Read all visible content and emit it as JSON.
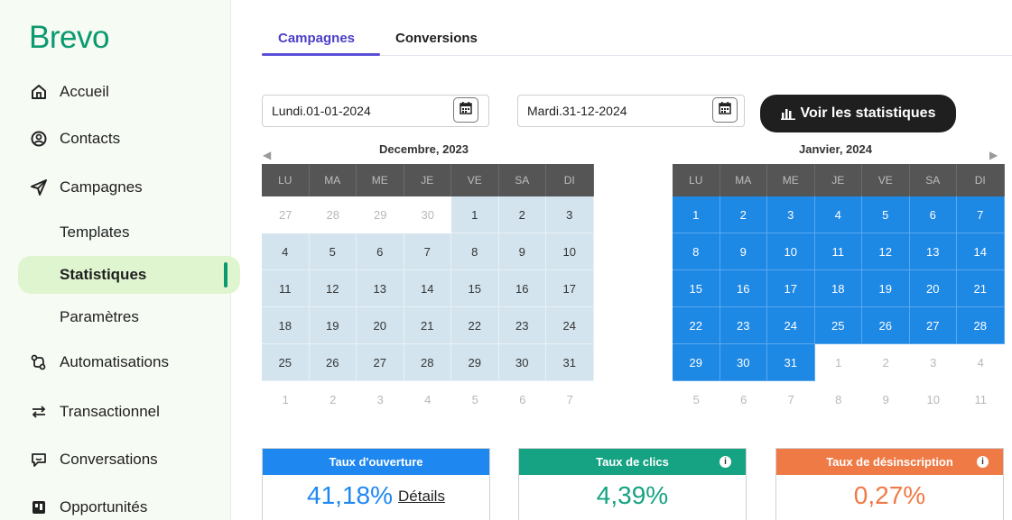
{
  "brand": {
    "logo": "Brevo"
  },
  "sidebar": {
    "items": [
      {
        "label": "Accueil",
        "icon": "home-icon"
      },
      {
        "label": "Contacts",
        "icon": "contacts-icon"
      },
      {
        "label": "Campagnes",
        "icon": "paper-plane-icon"
      }
    ],
    "sub_items": [
      {
        "label": "Templates"
      },
      {
        "label": "Statistiques",
        "active": true
      },
      {
        "label": "Paramètres"
      }
    ],
    "items_after": [
      {
        "label": "Automatisations",
        "icon": "automation-icon"
      },
      {
        "label": "Transactionnel",
        "icon": "transfer-icon"
      },
      {
        "label": "Conversations",
        "icon": "chat-icon"
      },
      {
        "label": "Opportunités",
        "icon": "opportunity-icon"
      }
    ]
  },
  "tabs": {
    "campagnes": "Campagnes",
    "conversions": "Conversions"
  },
  "dates": {
    "start": "Lundi.01-01-2024",
    "end": "Mardi.31-12-2024",
    "button": "Voir les statistiques"
  },
  "calendars": {
    "weekdays": [
      "LU",
      "MA",
      "ME",
      "JE",
      "VE",
      "SA",
      "DI"
    ],
    "left_title": "Decembre, 2023",
    "right_title": "Janvier, 2024",
    "left_days": [
      [
        "27",
        "28",
        "29",
        "30",
        "1",
        "2",
        "3"
      ],
      [
        "4",
        "5",
        "6",
        "7",
        "8",
        "9",
        "10"
      ],
      [
        "11",
        "12",
        "13",
        "14",
        "15",
        "16",
        "17"
      ],
      [
        "18",
        "19",
        "20",
        "21",
        "22",
        "23",
        "24"
      ],
      [
        "25",
        "26",
        "27",
        "28",
        "29",
        "30",
        "31"
      ],
      [
        "1",
        "2",
        "3",
        "4",
        "5",
        "6",
        "7"
      ]
    ],
    "right_days": [
      [
        "1",
        "2",
        "3",
        "4",
        "5",
        "6",
        "7"
      ],
      [
        "8",
        "9",
        "10",
        "11",
        "12",
        "13",
        "14"
      ],
      [
        "15",
        "16",
        "17",
        "18",
        "19",
        "20",
        "21"
      ],
      [
        "22",
        "23",
        "24",
        "25",
        "26",
        "27",
        "28"
      ],
      [
        "29",
        "30",
        "31",
        "1",
        "2",
        "3",
        "4"
      ],
      [
        "5",
        "6",
        "7",
        "8",
        "9",
        "10",
        "11"
      ]
    ]
  },
  "stats": {
    "open": {
      "label": "Taux d'ouverture",
      "value": "41,18%",
      "link": "Détails",
      "color": "#1e88f0"
    },
    "clicks": {
      "label": "Taux de clics",
      "value": "4,39%",
      "color": "#16a383"
    },
    "unsub": {
      "label": "Taux de désinscription",
      "value": "0,27%",
      "color": "#ef7a45"
    }
  },
  "colors": {
    "brand": "#0b996e",
    "tab_active": "#4b3fc7",
    "selected_day": "#1e88e5",
    "range_day": "#d3e4ee"
  }
}
